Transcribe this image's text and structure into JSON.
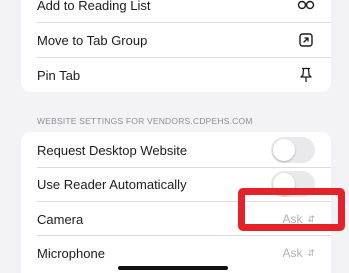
{
  "menu": {
    "reading_list_label": "Add to Reading List",
    "reading_list_icon": "glasses-icon",
    "tab_group_label": "Move to Tab Group",
    "tab_group_icon": "move-to-tab-group-icon",
    "pin_tab_label": "Pin Tab",
    "pin_tab_icon": "pin-icon"
  },
  "website_settings": {
    "header": "WEBSITE SETTINGS FOR VENDORS.CDPEHS.COM",
    "request_desktop_label": "Request Desktop Website",
    "request_desktop_on": false,
    "reader_label": "Use Reader Automatically",
    "reader_on": false,
    "camera_label": "Camera",
    "camera_value": "Ask",
    "microphone_label": "Microphone",
    "microphone_value": "Ask"
  },
  "colors": {
    "highlight": "#e5222a",
    "background": "#f2f2f7",
    "secondary_text": "#8e8e93"
  }
}
